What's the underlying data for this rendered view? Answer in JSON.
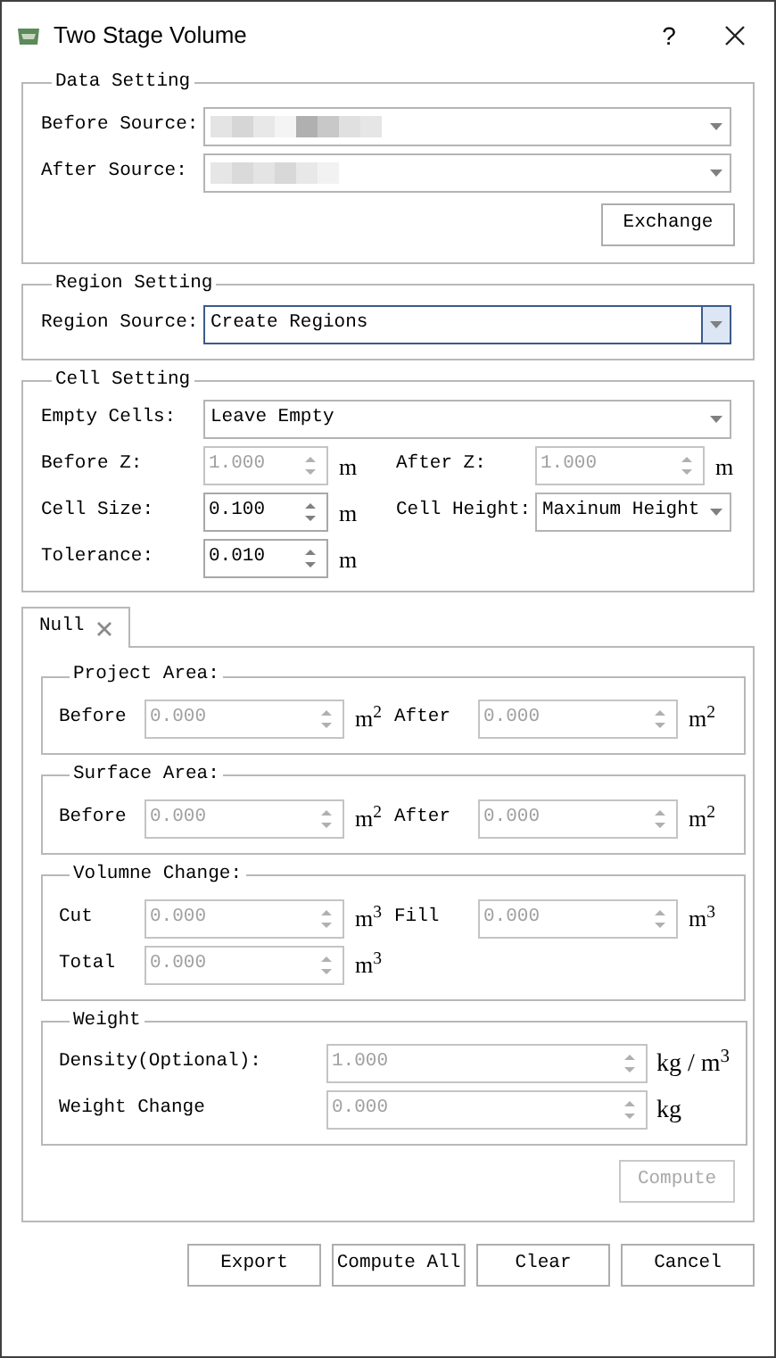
{
  "window": {
    "title": "Two Stage Volume",
    "help": "?"
  },
  "data_setting": {
    "title": "Data Setting",
    "sources": [
      {
        "label": "Before Source:"
      },
      {
        "label": "After Source:"
      }
    ],
    "button": "Exchange"
  },
  "region_setting": {
    "title": "Region Setting",
    "label": "Region Source:",
    "value": "Create Regions",
    "focused": true
  },
  "cell_setting": {
    "title": "Cell Setting",
    "empty_cells": {
      "label": "Empty Cells:",
      "value": "Leave Empty"
    },
    "rows": [
      [
        {
          "label": "Before Z:",
          "value": "1.000",
          "unit": "m",
          "disabled": true,
          "kind": "spin"
        },
        {
          "label": "After Z:",
          "value": "1.000",
          "unit": "m",
          "disabled": true,
          "kind": "spin"
        }
      ],
      [
        {
          "label": "Cell Size:",
          "value": "0.100",
          "unit": "m",
          "disabled": false,
          "kind": "spin"
        },
        {
          "label": "Cell Height:",
          "value": "Maxinum Height",
          "kind": "combo"
        }
      ],
      [
        {
          "label": "Tolerance:",
          "value": "0.010",
          "unit": "m",
          "disabled": false,
          "kind": "spin"
        }
      ]
    ]
  },
  "tabs": [
    {
      "label": "Null",
      "selected": true
    }
  ],
  "result_groups": [
    {
      "title": "Project Area:",
      "rows": [
        [
          {
            "label": "Before",
            "value": "0.000",
            "unit": "m$^{2}$",
            "disabled": true
          },
          {
            "label": "After",
            "value": "0.000",
            "unit": "m$^{2}$",
            "disabled": true
          }
        ]
      ]
    },
    {
      "title": "Surface Area:",
      "rows": [
        [
          {
            "label": "Before",
            "value": "0.000",
            "unit": "m$^{2}$",
            "disabled": true
          },
          {
            "label": "After",
            "value": "0.000",
            "unit": "m$^{2}$",
            "disabled": true
          }
        ]
      ]
    },
    {
      "title": "Volumne Change:",
      "rows": [
        [
          {
            "label": "Cut",
            "value": "0.000",
            "unit": "m$^{3}$",
            "disabled": true
          },
          {
            "label": "Fill",
            "value": "0.000",
            "unit": "m$^{3}$",
            "disabled": true
          }
        ],
        [
          {
            "label": "Total",
            "value": "0.000",
            "unit": "m$^{3}$",
            "disabled": true
          }
        ]
      ]
    }
  ],
  "weight": {
    "title": "Weight",
    "rows": [
      {
        "label": "Density(Optional):",
        "value": "1.000",
        "unit": "kg / m$^{3}$",
        "disabled": true
      },
      {
        "label": "Weight Change",
        "value": "0.000",
        "unit": "kg",
        "disabled": true
      }
    ]
  },
  "compute": {
    "label": "Compute",
    "disabled": true
  },
  "buttons": [
    "Export",
    "Compute All",
    "Clear",
    "Cancel"
  ]
}
